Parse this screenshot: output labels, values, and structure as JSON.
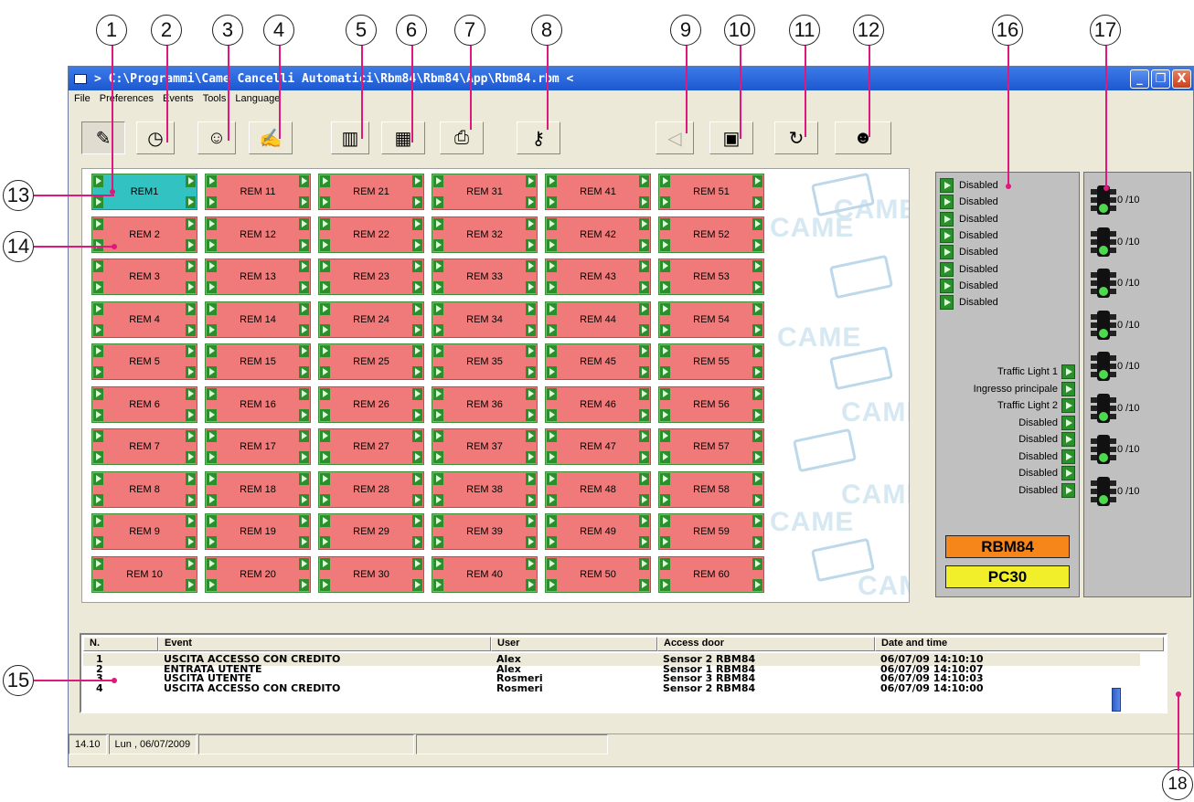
{
  "window": {
    "title": "> C:\\Programmi\\Came Cancelli Automatici\\Rbm84\\Rbm84\\App\\Rbm84.rbm <",
    "buttons": {
      "minimize": "_",
      "restore": "❐",
      "close": "X"
    }
  },
  "menu": [
    "File",
    "Preferences",
    "Events",
    "Tools",
    "Language"
  ],
  "toolbar": [
    {
      "name": "settings-tool-icon",
      "glyph": "✎",
      "state": "pressed"
    },
    {
      "name": "clock-icon",
      "glyph": "◷",
      "state": "normal"
    },
    {
      "name": "user-icon",
      "glyph": "☺",
      "state": "normal"
    },
    {
      "name": "write-icon",
      "glyph": "✍",
      "state": "normal"
    },
    {
      "name": "book-icon",
      "glyph": "▥",
      "state": "normal"
    },
    {
      "name": "calendar-icon",
      "glyph": "▦",
      "state": "normal"
    },
    {
      "name": "printer-icon",
      "glyph": "⎙",
      "state": "normal"
    },
    {
      "name": "key-icon",
      "glyph": "⚷",
      "state": "normal"
    },
    {
      "name": "speaker-icon",
      "glyph": "◁",
      "state": "disabled"
    },
    {
      "name": "lock-icon",
      "glyph": "▣",
      "state": "normal"
    },
    {
      "name": "refresh-icon",
      "glyph": "↻",
      "state": "normal"
    },
    {
      "name": "users-icon",
      "glyph": "☻",
      "state": "normal"
    }
  ],
  "callouts": [
    "1",
    "2",
    "3",
    "4",
    "5",
    "6",
    "7",
    "8",
    "9",
    "10",
    "11",
    "12",
    "13",
    "14",
    "15",
    "16",
    "17",
    "18"
  ],
  "watermark": {
    "text": "CAME",
    "color": "#d6e8f2"
  },
  "remotes": {
    "columns": [
      [
        "REM1",
        "REM 2",
        "REM 3",
        "REM 4",
        "REM 5",
        "REM 6",
        "REM 7",
        "REM 8",
        "REM 9",
        "REM 10"
      ],
      [
        "REM 11",
        "REM 12",
        "REM 13",
        "REM 14",
        "REM 15",
        "REM 16",
        "REM 17",
        "REM 18",
        "REM 19",
        "REM 20"
      ],
      [
        "REM 21",
        "REM 22",
        "REM 23",
        "REM 24",
        "REM 25",
        "REM 26",
        "REM 27",
        "REM 28",
        "REM 29",
        "REM 30"
      ],
      [
        "REM 31",
        "REM 32",
        "REM 33",
        "REM 34",
        "REM 35",
        "REM 36",
        "REM 37",
        "REM 38",
        "REM 39",
        "REM 40"
      ],
      [
        "REM 41",
        "REM 42",
        "REM 43",
        "REM 44",
        "REM 45",
        "REM 46",
        "REM 47",
        "REM 48",
        "REM 49",
        "REM 50"
      ],
      [
        "REM 51",
        "REM 52",
        "REM 53",
        "REM 54",
        "REM 55",
        "REM 56",
        "REM 57",
        "REM 58",
        "REM 59",
        "REM 60"
      ]
    ],
    "active": "REM1",
    "colors": {
      "normal": "#f07a7a",
      "active": "#33c2c2",
      "arrow": "#2b8f2b"
    }
  },
  "inputs_panel": [
    "Disabled",
    "Disabled",
    "Disabled",
    "Disabled",
    "Disabled",
    "Disabled",
    "Disabled",
    "Disabled"
  ],
  "outputs_panel": [
    "Traffic Light 1",
    "Ingresso principale",
    "Traffic Light 2",
    "Disabled",
    "Disabled",
    "Disabled",
    "Disabled",
    "Disabled"
  ],
  "devices": {
    "primary": "RBM84",
    "secondary": "PC30",
    "primary_color": "#f6861a",
    "secondary_color": "#f0ef2a"
  },
  "traffic_lights": [
    "0 /10",
    "0 /10",
    "0 /10",
    "0 /10",
    "0 /10",
    "0 /10",
    "0 /10",
    "0 /10"
  ],
  "events": {
    "columns": [
      "N.",
      "Event",
      "User",
      "Access door",
      "Date and time"
    ],
    "rows": [
      [
        "1",
        "USCITA ACCESSO CON CREDITO",
        "Alex",
        "Sensor 2 RBM84",
        "06/07/09 14:10:10"
      ],
      [
        "2",
        "ENTRATA UTENTE",
        "Alex",
        "Sensor 1 RBM84",
        "06/07/09 14:10:07"
      ],
      [
        "3",
        "USCITA UTENTE",
        "Rosmeri",
        "Sensor 3 RBM84",
        "06/07/09 14:10:03"
      ],
      [
        "4",
        "USCITA ACCESSO CON CREDITO",
        "Rosmeri",
        "Sensor 2 RBM84",
        "06/07/09 14:10:00"
      ]
    ]
  },
  "statusbar": {
    "time": "14.10",
    "date": "Lun , 06/07/2009"
  },
  "accent": "#e0177d"
}
